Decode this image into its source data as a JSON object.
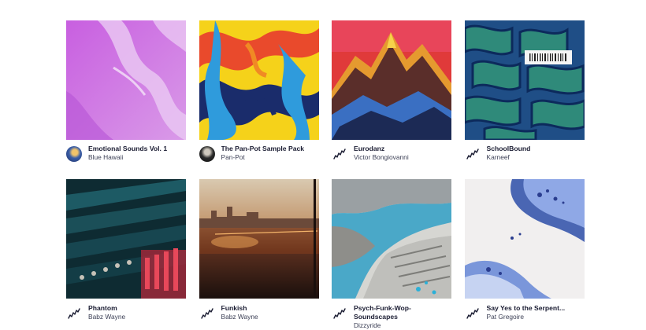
{
  "packs": [
    {
      "title": "Emotional Sounds Vol. 1",
      "artist": "Blue Hawaii",
      "icon": "avatar"
    },
    {
      "title": "The Pan-Pot Sample Pack",
      "artist": "Pan-Pot",
      "icon": "avatar"
    },
    {
      "title": "Eurodanz",
      "artist": "Victor Bongiovanni",
      "icon": "waveform-icon"
    },
    {
      "title": "SchoolBound",
      "artist": "Karneef",
      "icon": "waveform-icon"
    },
    {
      "title": "Phantom",
      "artist": "Babz Wayne",
      "icon": "waveform-icon"
    },
    {
      "title": "Funkish",
      "artist": "Babz Wayne",
      "icon": "waveform-icon"
    },
    {
      "title": "Psych-Funk-Wop-Soundscapes",
      "artist": "Dizzyride",
      "icon": "waveform-icon"
    },
    {
      "title": "Say Yes to the Serpent...",
      "artist": "Pat Gregoire",
      "icon": "waveform-icon"
    }
  ],
  "colors": {
    "title": "#1b1d33",
    "artist": "#3b3f55",
    "background": "#ffffff"
  }
}
